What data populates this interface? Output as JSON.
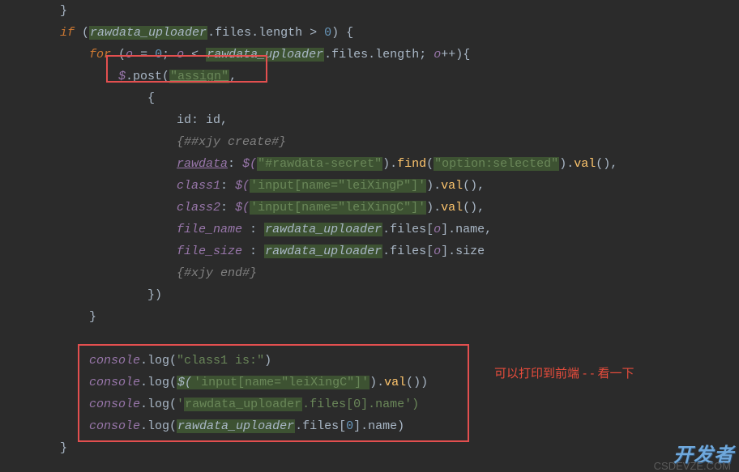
{
  "code": {
    "l0": {
      "brace": "}"
    },
    "l1": {
      "if": "if",
      "p1": " (",
      "var": "rawdata_uploader",
      "rest": ".files.length > ",
      "zero": "0",
      "tail": ") {"
    },
    "l2": {
      "for": "for",
      "p1": " (",
      "o": "o ",
      "eq": "= ",
      "zero": "0",
      "semi1": "; ",
      "o2": "o ",
      "lt": "< ",
      "var": "rawdata_uploader",
      "mid": ".files.length; ",
      "o3": "o",
      "inc": "++){"
    },
    "l3": {
      "dollar": "$",
      "post": ".post(",
      "str": "\"assign\"",
      "comma": ","
    },
    "l4": {
      "brace": "{"
    },
    "l5": {
      "a": "id: id,",
      "b": ""
    },
    "l6": {
      "txt": "{##xjy create#}"
    },
    "l7": {
      "key": "rawdata",
      "colon": ": ",
      "jq": "$(",
      "sel": "\"#rawdata-secret\"",
      "p1": ").",
      "find": "find",
      "p2": "(",
      "opt": "\"option:selected\"",
      "p3": ").",
      "val": "val",
      "p4": "(),"
    },
    "l8": {
      "key": "class1",
      "colon": ": ",
      "jq": "$(",
      "sel": "'input[name=\"leiXingP\"]'",
      "p1": ").",
      "val": "val",
      "p2": "(),"
    },
    "l9": {
      "key": "class2",
      "colon": ": ",
      "jq": "$(",
      "sel": "'input[name=\"leiXingC\"]'",
      "p1": ").",
      "val": "val",
      "p2": "(),"
    },
    "l10": {
      "key": "file_name ",
      "colon": ": ",
      "var": "rawdata_uploader",
      "rest": ".files[",
      "o": "o",
      "tail": "].name,"
    },
    "l11": {
      "key": "file_size ",
      "colon": ": ",
      "var": "rawdata_uploader",
      "rest": ".files[",
      "o": "o",
      "tail": "].size"
    },
    "l12": {
      "txt": "{#xjy end#}"
    },
    "l13": {
      "end": "})"
    },
    "l14": {
      "brace": "}"
    },
    "l15": "",
    "l16": {
      "console": "console",
      "log": ".log(",
      "str": "\"class1 is:\"",
      "end": ")"
    },
    "l17": {
      "console": "console",
      "log": ".log(",
      "jq": "$(",
      "sel": "'input[name=\"leiXingC\"]'",
      "p1": ").",
      "val": "val",
      "p2": "())"
    },
    "l18": {
      "console": "console",
      "log": ".log(",
      "q1": "'",
      "var": "rawdata_uploader",
      "rest": ".files[",
      "zero": "0",
      "tail": "].name",
      "q2": "')"
    },
    "l19": {
      "console": "console",
      "log": ".log(",
      "var": "rawdata_uploader",
      "rest": ".files[",
      "zero": "0",
      "tail": "].name)"
    },
    "l20": {
      "brace": "}"
    }
  },
  "annotation": "可以打印到前端 - - 看一下",
  "watermark": "开发者",
  "watermark_sub": "CSDEVZE.COM"
}
